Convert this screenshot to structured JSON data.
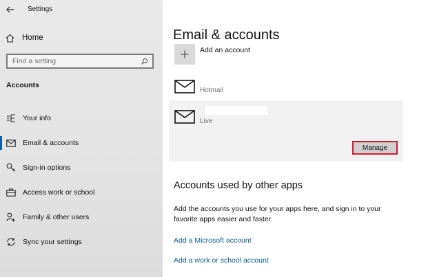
{
  "sidebar": {
    "app_title": "Settings",
    "home_label": "Home",
    "search_placeholder": "Find a setting",
    "section_title": "Accounts",
    "items": [
      {
        "label": "Your info",
        "icon": "person-card-icon"
      },
      {
        "label": "Email & accounts",
        "icon": "mail-icon",
        "active": true
      },
      {
        "label": "Sign-in options",
        "icon": "key-icon"
      },
      {
        "label": "Access work or school",
        "icon": "briefcase-icon"
      },
      {
        "label": "Family & other users",
        "icon": "person-add-icon"
      },
      {
        "label": "Sync your settings",
        "icon": "sync-icon"
      }
    ]
  },
  "main": {
    "title": "Email & accounts",
    "add_account_label": "Add an account",
    "accounts": [
      {
        "type": "Hotmail"
      },
      {
        "type": "Live",
        "email": ""
      }
    ],
    "manage_label": "Manage",
    "other_apps_heading": "Accounts used by other apps",
    "other_apps_desc": "Add the accounts you use for your apps here, and sign in to your favorite apps easier and faster.",
    "links": [
      "Add a Microsoft account",
      "Add a work or school account"
    ]
  },
  "colors": {
    "accent": "#0063b1",
    "link": "#0b5a8c",
    "highlight_border": "#d11a2a"
  }
}
